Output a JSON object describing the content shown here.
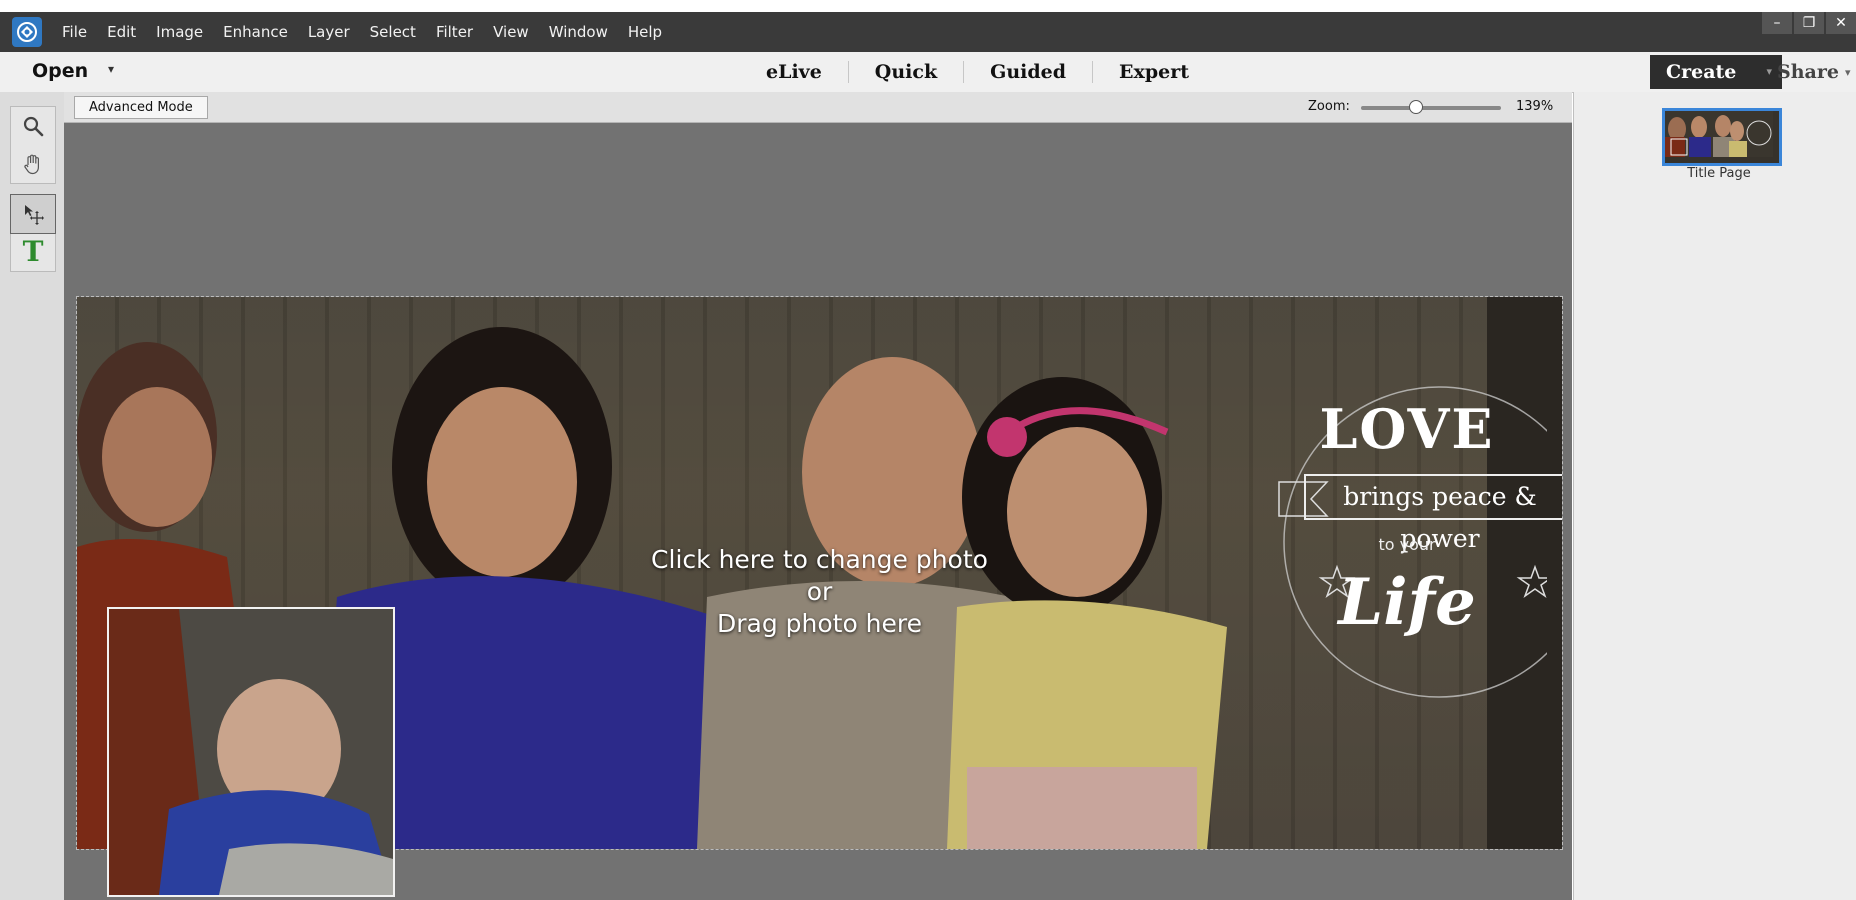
{
  "menu": {
    "items": [
      "File",
      "Edit",
      "Image",
      "Enhance",
      "Layer",
      "Select",
      "Filter",
      "View",
      "Window",
      "Help"
    ]
  },
  "window_controls": {
    "minimize": "–",
    "restore": "❐",
    "close": "✕"
  },
  "modebar": {
    "open_label": "Open",
    "tabs": [
      "eLive",
      "Quick",
      "Guided",
      "Expert"
    ],
    "create_label": "Create",
    "share_label": "Share"
  },
  "options": {
    "advanced_mode_label": "Advanced Mode",
    "zoom_label": "Zoom:",
    "zoom_value": "139%",
    "zoom_fraction": 0.39
  },
  "canvas": {
    "placeholder": {
      "line1": "Click here to change photo",
      "line2": "or",
      "line3": "Drag photo here"
    },
    "quote": {
      "title": "LOVE",
      "line": "brings peace & power",
      "to": "to your",
      "life": "Life"
    }
  },
  "pages_panel": {
    "pages": [
      {
        "label": "Title Page",
        "selected": true
      }
    ]
  },
  "colors": {
    "menubar_bg": "#3a3a3a",
    "canvas_bg": "#727272",
    "accent_blue": "#3b86d9",
    "text_tool_green": "#2e8b2e"
  },
  "icons": {
    "zoom": "magnifier-icon",
    "hand": "hand-icon",
    "move": "move-icon",
    "text": "text-icon"
  }
}
